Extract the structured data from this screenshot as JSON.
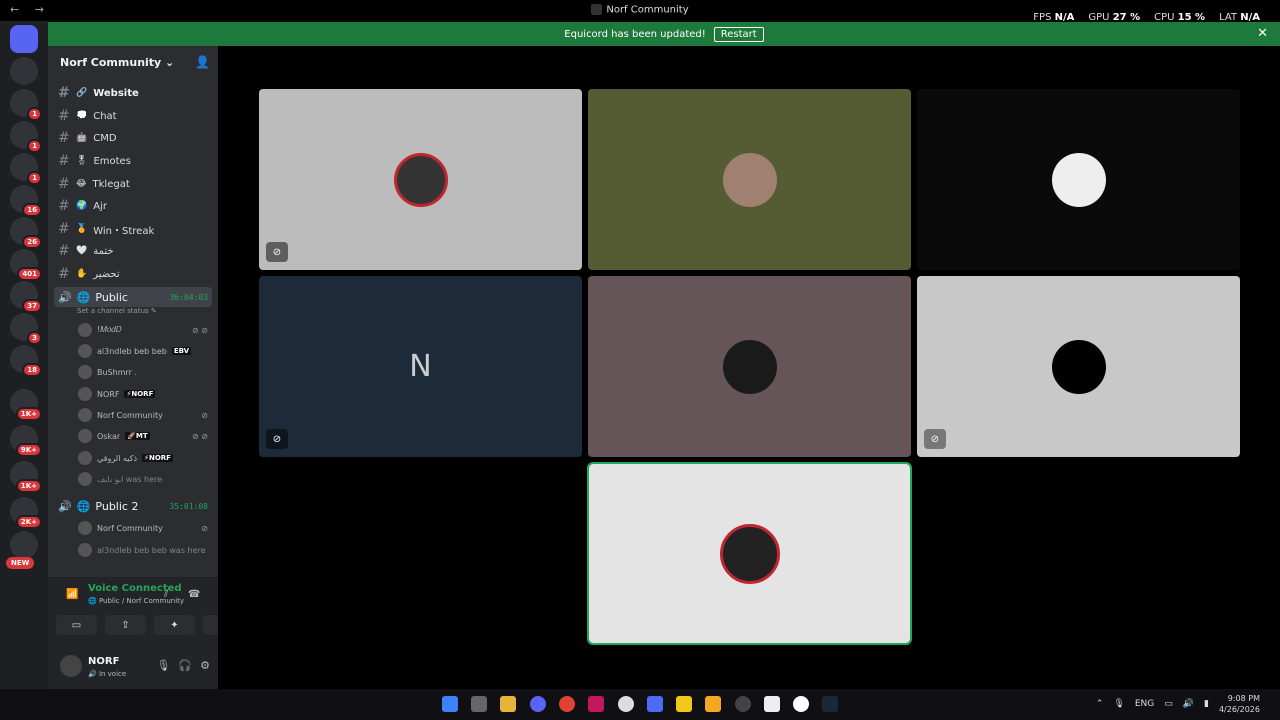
{
  "window": {
    "title": "Norf Community",
    "nav_arrows": "← →"
  },
  "perf": {
    "fps_label": "FPS",
    "fps_value": "N/A",
    "gpu_label": "GPU",
    "gpu_value": "27 %",
    "cpu_label": "CPU",
    "cpu_value": "15 %",
    "lat_label": "LAT",
    "lat_value": "N/A"
  },
  "notice": {
    "text": "Equicord has been updated!",
    "restart": "Restart",
    "close": "✕"
  },
  "server": {
    "name": "Norf Community ⌄",
    "add_icon": "add-person-icon"
  },
  "servers": {
    "badges": [
      "1",
      "1",
      "1",
      "16",
      "26",
      "401",
      "37",
      "3",
      "18",
      "1K+",
      "9K+",
      "1K+",
      "2K+"
    ],
    "new": "NEW"
  },
  "channels": [
    {
      "name": "Website",
      "emoji": "🔗",
      "bold": true
    },
    {
      "name": "Chat",
      "emoji": "💭"
    },
    {
      "name": "CMD",
      "emoji": "🤖"
    },
    {
      "name": "Emotes",
      "emoji": "🎖"
    },
    {
      "name": "Tklegat",
      "emoji": "😂"
    },
    {
      "name": "Ajr",
      "emoji": "🌍"
    },
    {
      "name": "Win・Streak",
      "emoji": "🏅"
    },
    {
      "name": "ختمة",
      "emoji": "🤍"
    },
    {
      "name": "تحضير",
      "emoji": "✋"
    }
  ],
  "voice1": {
    "name": "Public",
    "timer": "36:04:03",
    "status": "Set a channel status ✎",
    "users": [
      {
        "name": "!𝑀𝑜𝑑𝐷",
        "tag": ""
      },
      {
        "name": "al3ndleb beb beb",
        "tag": "EBV"
      },
      {
        "name": "BuShmrr .",
        "tag": ""
      },
      {
        "name": "NORF",
        "tag": "⚡NORF"
      },
      {
        "name": "Norf Community",
        "tag": ""
      },
      {
        "name": "Oskar",
        "tag": "🚀MT"
      },
      {
        "name": "ذكيه الروقي",
        "tag": "⚡NORF"
      },
      {
        "name": "ابو نايف was here",
        "tag": ""
      }
    ]
  },
  "voice2": {
    "name": "Public 2",
    "timer": "35:01:08",
    "users": [
      {
        "name": "Norf Community"
      },
      {
        "name": "al3ndleb beb beb was here"
      }
    ]
  },
  "vpanel": {
    "title": "Voice Connected",
    "sub": "🌐 Public / Norf Community"
  },
  "user": {
    "name": "NORF",
    "status": "🔊 In voice"
  },
  "tray": {
    "lang": "ENG",
    "time": "9:08 PM",
    "date": "4/26/2026"
  },
  "colors": {
    "accent": "#23a55a",
    "notice": "#1d7a3a",
    "badge": "#da373c"
  }
}
